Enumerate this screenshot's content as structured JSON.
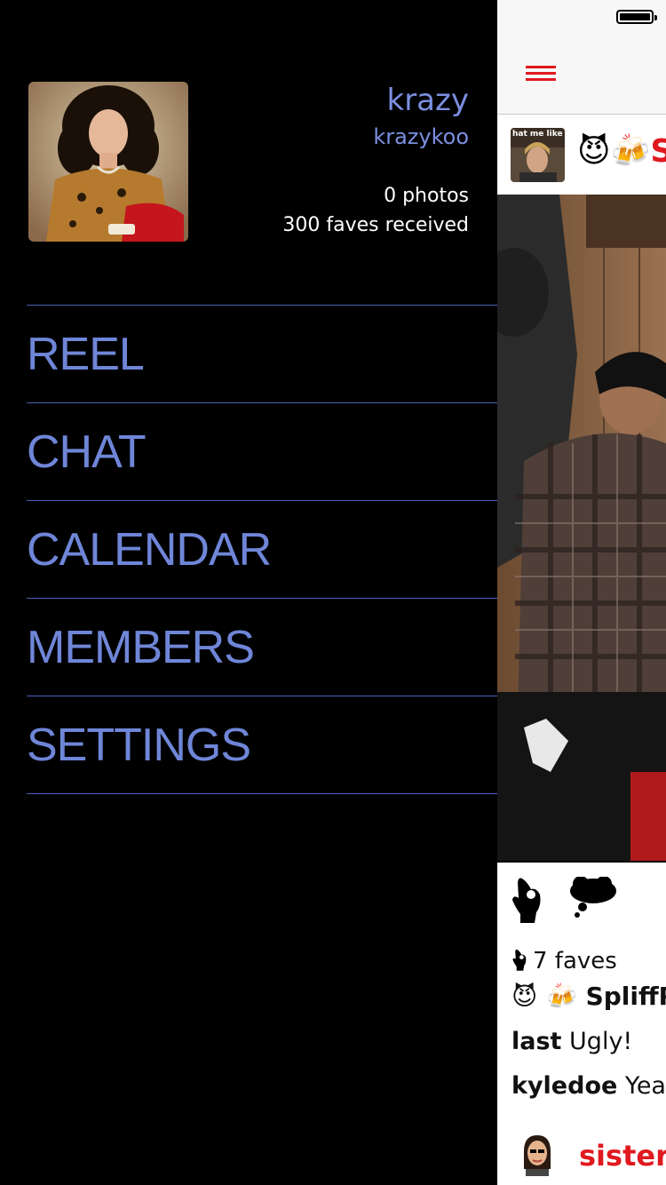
{
  "drawer": {
    "profile": {
      "name": "krazy",
      "handle": "krazykoo",
      "photos_text": "0 photos",
      "faves_text": "300 faves received"
    },
    "menu": [
      {
        "label": "REEL"
      },
      {
        "label": "CHAT"
      },
      {
        "label": "CALENDAR"
      },
      {
        "label": "MEMBERS"
      },
      {
        "label": "SETTINGS"
      }
    ]
  },
  "main": {
    "post": {
      "thumb_caption": "hat me like",
      "author_emoji": "😈🍻",
      "author_fragment": "S",
      "faves_text": "7 faves",
      "caption_emoji": "😈 🍻",
      "caption_author": "SpliffP",
      "comments": [
        {
          "user": "last",
          "text": "Ugly!"
        },
        {
          "user": "kyledoe",
          "text": "Yea."
        }
      ]
    },
    "next_post": {
      "author": "sister"
    }
  },
  "colors": {
    "accent_red": "#e0191f",
    "menu_blue": "#6f86d8",
    "divider_blue": "#4b5fb8"
  }
}
